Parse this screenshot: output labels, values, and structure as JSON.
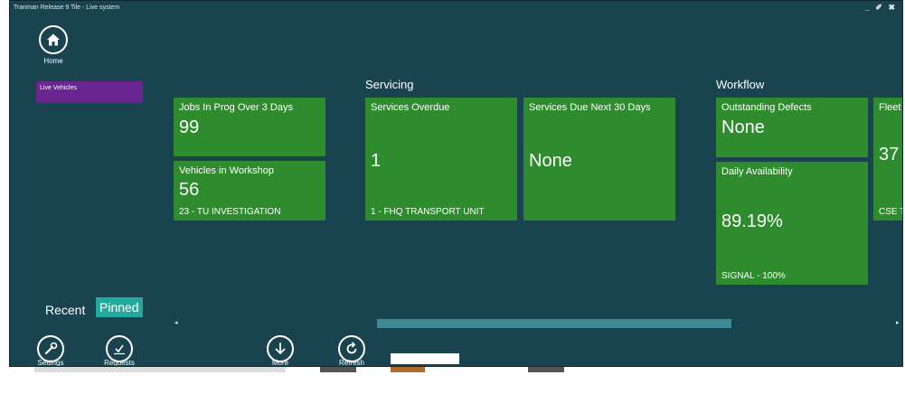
{
  "window": {
    "title": "Tranman Release 9 Tile - Live system",
    "controls": "_ ✐ ✖"
  },
  "home": {
    "label": "Home"
  },
  "sidebar": {
    "live_vehicles": "Live Vehicles"
  },
  "groups": {
    "servicing": "Servicing",
    "workflow": "Workflow"
  },
  "tiles": {
    "jobs": {
      "name": "Jobs In Prog Over 3 Days",
      "value": "99"
    },
    "workshop": {
      "name": "Vehicles in Workshop",
      "value": "56",
      "sub": "23 - TU INVESTIGATION"
    },
    "overdue": {
      "name": "Services Overdue",
      "value": "1",
      "sub": "1 - FHQ TRANSPORT UNIT"
    },
    "due30": {
      "name": "Services Due Next 30 Days",
      "value": "None"
    },
    "defects": {
      "name": "Outstanding Defects",
      "value": "None"
    },
    "availability": {
      "name": "Daily Availability",
      "value": "89.19%",
      "sub": "SIGNAL - 100%"
    },
    "fleet": {
      "name": "Fleet",
      "value": "37",
      "sub": "CSE T"
    }
  },
  "tabs": {
    "recent": "Recent",
    "pinned": "Pinned"
  },
  "scroll": {
    "left_arrow": "◂",
    "right_arrow": "▸"
  },
  "toolbar": {
    "settings": "Settings",
    "requests": "Requests",
    "more": "More",
    "refresh": "Refresh"
  },
  "colors": {
    "background": "#1a4350",
    "tile": "#2e8b2e",
    "live_vehicles": "#6a2590",
    "pinned_tab": "#23a99e"
  }
}
